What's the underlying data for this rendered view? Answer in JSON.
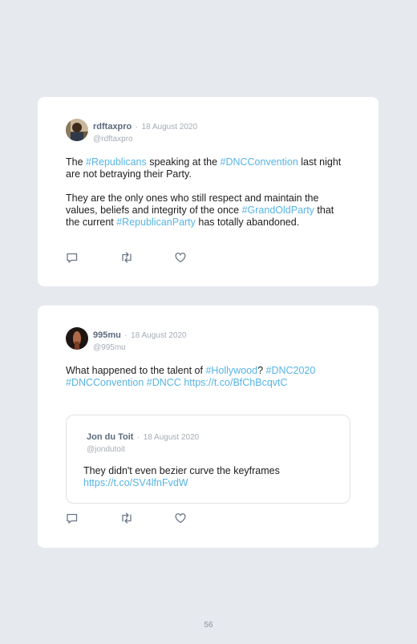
{
  "posts": [
    {
      "author": "rdftaxpro",
      "date": "18 August 2020",
      "handle": "@rdftaxpro",
      "paragraphs": [
        [
          {
            "text": "The ",
            "tag": false
          },
          {
            "text": "#Republicans",
            "tag": true
          },
          {
            "text": " speaking at the ",
            "tag": false
          },
          {
            "text": "#DNCConvention",
            "tag": true
          },
          {
            "text": " last night are not betraying their Party.",
            "tag": false
          }
        ],
        [
          {
            "text": "They are the only ones who still respect and maintain the values, beliefs and integrity of the once ",
            "tag": false
          },
          {
            "text": "#GrandOldParty",
            "tag": true
          },
          {
            "text": " that the current ",
            "tag": false
          },
          {
            "text": "#RepublicanParty",
            "tag": true
          },
          {
            "text": " has totally abandoned.",
            "tag": false
          }
        ]
      ]
    },
    {
      "author": "995mu",
      "date": "18 August 2020",
      "handle": "@995mu",
      "paragraphs": [
        [
          {
            "text": "What happened to the talent of ",
            "tag": false
          },
          {
            "text": "#Hollywood",
            "tag": true
          },
          {
            "text": "? ",
            "tag": false
          },
          {
            "text": "#DNC2020",
            "tag": true
          },
          {
            "text": " ",
            "tag": false
          },
          {
            "text": "#DNCConvention",
            "tag": true
          },
          {
            "text": " ",
            "tag": false
          },
          {
            "text": "#DNCC",
            "tag": true
          },
          {
            "text": " ",
            "tag": false
          },
          {
            "text": "https://t.co/BfChBcqvtC",
            "tag": true
          }
        ]
      ],
      "quote": {
        "author": "Jon du Toit",
        "date": "18 August 2020",
        "handle": "@jondutoit",
        "paragraphs": [
          [
            {
              "text": "They didn't even bezier curve the keyframes ",
              "tag": false
            },
            {
              "text": "https://t.co/SV4lfnFvdW",
              "tag": true
            }
          ]
        ]
      }
    }
  ],
  "date_separator": "·",
  "icons": [
    "reply-icon",
    "retweet-icon",
    "like-icon"
  ],
  "colors": {
    "hashtag": "#56b4e4",
    "background": "#e6e9ee",
    "card": "#ffffff"
  },
  "page_number": "56"
}
